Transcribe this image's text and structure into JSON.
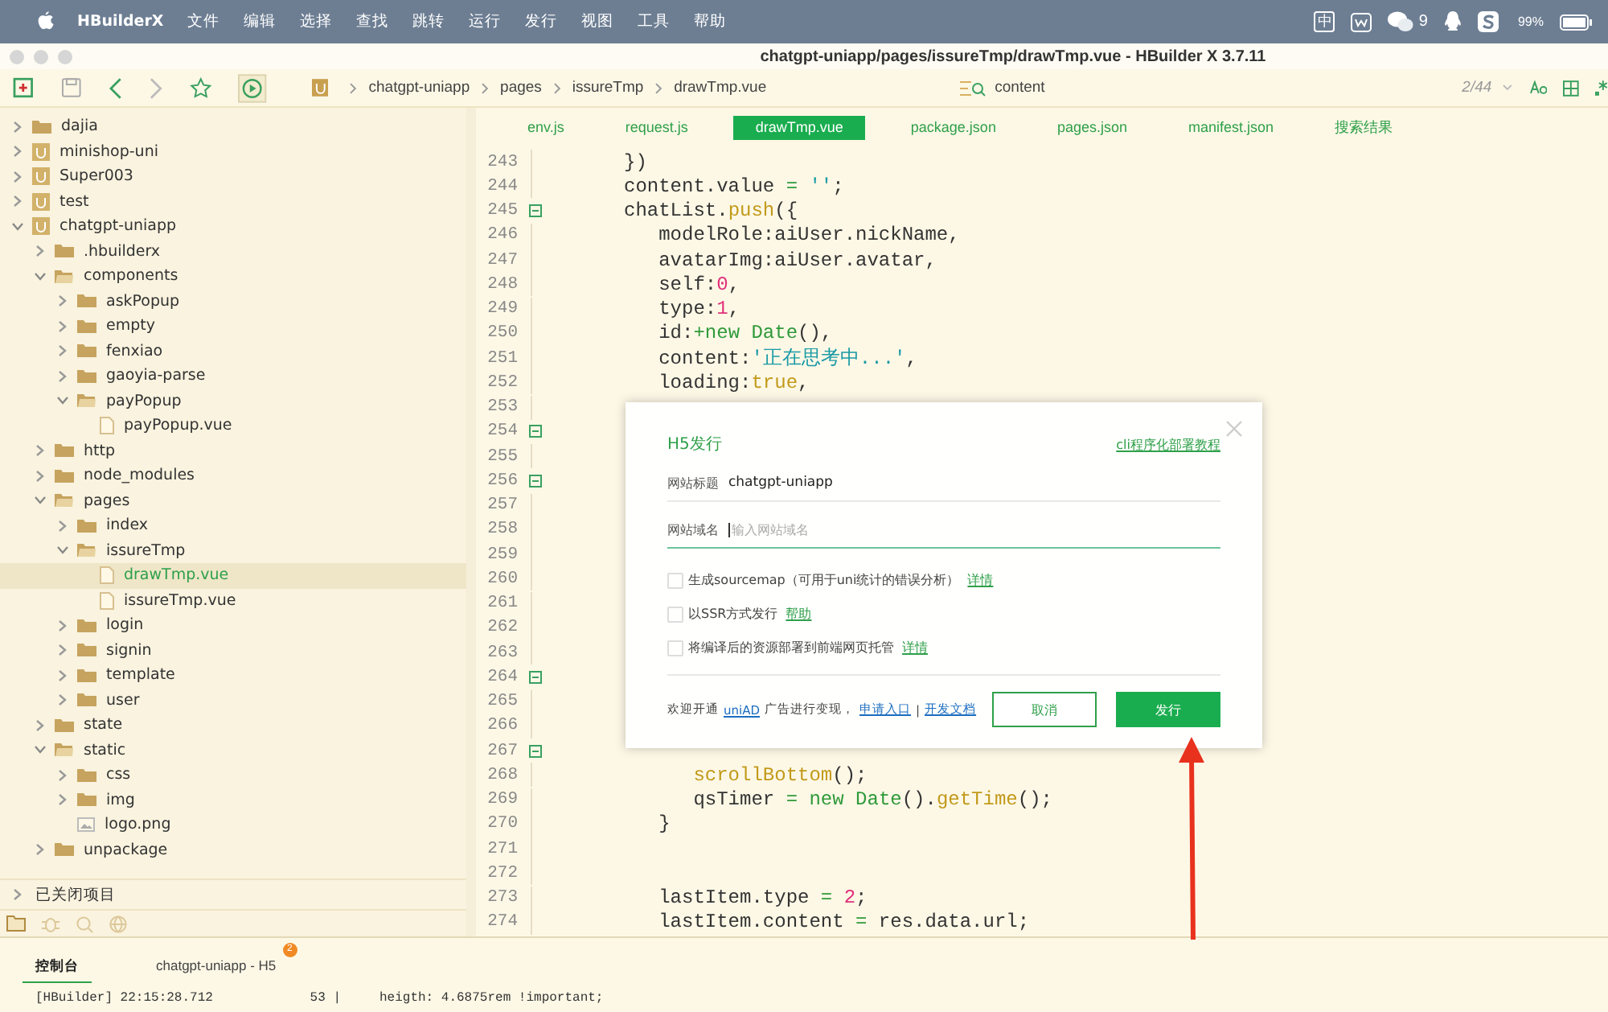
{
  "menubar": {
    "items": [
      "HBuilderX",
      "文件",
      "编辑",
      "选择",
      "查找",
      "跳转",
      "运行",
      "发行",
      "视图",
      "工具",
      "帮助"
    ],
    "input_method": "中",
    "wechat_count": "9",
    "battery": "99%"
  },
  "window": {
    "title": "chatgpt-uniapp/pages/issureTmp/drawTmp.vue - HBuilder X 3.7.11"
  },
  "toolbar": {
    "breadcrumb": [
      "chatgpt-uniapp",
      "pages",
      "issureTmp",
      "drawTmp.vue"
    ],
    "search": {
      "value": "content"
    },
    "match_count": "2/44"
  },
  "tabs": [
    {
      "label": "env.js",
      "selected": false
    },
    {
      "label": "request.js",
      "selected": false
    },
    {
      "label": "drawTmp.vue",
      "selected": true
    },
    {
      "label": "package.json",
      "selected": false
    },
    {
      "label": "pages.json",
      "selected": false
    },
    {
      "label": "manifest.json",
      "selected": false
    },
    {
      "label": "搜索结果",
      "selected": false
    }
  ],
  "sidebar": {
    "tree": [
      {
        "label": "dajia",
        "kind": "folder",
        "expanded": false,
        "selected": false
      },
      {
        "label": "minishop-uni",
        "kind": "project",
        "expanded": false,
        "selected": false
      },
      {
        "label": "Super003",
        "kind": "project",
        "expanded": false,
        "selected": false
      },
      {
        "label": "test",
        "kind": "project",
        "expanded": false,
        "selected": false
      },
      {
        "label": "chatgpt-uniapp",
        "kind": "project",
        "expanded": true,
        "selected": false,
        "children": [
          {
            "label": ".hbuilderx",
            "kind": "folder",
            "expanded": false,
            "selected": false
          },
          {
            "label": "components",
            "kind": "folder",
            "expanded": true,
            "selected": false,
            "children": [
              {
                "label": "askPopup",
                "kind": "folder",
                "expanded": false,
                "selected": false
              },
              {
                "label": "empty",
                "kind": "folder",
                "expanded": false,
                "selected": false
              },
              {
                "label": "fenxiao",
                "kind": "folder",
                "expanded": false,
                "selected": false
              },
              {
                "label": "gaoyia-parse",
                "kind": "folder",
                "expanded": false,
                "selected": false
              },
              {
                "label": "payPopup",
                "kind": "folder",
                "expanded": true,
                "selected": false,
                "children": [
                  {
                    "label": "payPopup.vue",
                    "kind": "file",
                    "selected": false
                  }
                ]
              }
            ]
          },
          {
            "label": "http",
            "kind": "folder",
            "expanded": false,
            "selected": false
          },
          {
            "label": "node_modules",
            "kind": "folder",
            "expanded": false,
            "selected": false
          },
          {
            "label": "pages",
            "kind": "folder",
            "expanded": true,
            "selected": false,
            "children": [
              {
                "label": "index",
                "kind": "folder",
                "expanded": false,
                "selected": false
              },
              {
                "label": "issureTmp",
                "kind": "folder",
                "expanded": true,
                "selected": false,
                "children": [
                  {
                    "label": "drawTmp.vue",
                    "kind": "file",
                    "selected": true
                  },
                  {
                    "label": "issureTmp.vue",
                    "kind": "file",
                    "selected": false
                  }
                ]
              },
              {
                "label": "login",
                "kind": "folder",
                "expanded": false,
                "selected": false
              },
              {
                "label": "signin",
                "kind": "folder",
                "expanded": false,
                "selected": false
              },
              {
                "label": "template",
                "kind": "folder",
                "expanded": false,
                "selected": false
              },
              {
                "label": "user",
                "kind": "folder",
                "expanded": false,
                "selected": false
              }
            ]
          },
          {
            "label": "state",
            "kind": "folder",
            "expanded": false,
            "selected": false
          },
          {
            "label": "static",
            "kind": "folder",
            "expanded": true,
            "selected": false,
            "children": [
              {
                "label": "css",
                "kind": "folder",
                "expanded": false,
                "selected": false
              },
              {
                "label": "img",
                "kind": "folder",
                "expanded": false,
                "selected": false
              },
              {
                "label": "logo.png",
                "kind": "image",
                "selected": false
              }
            ]
          },
          {
            "label": "unpackage",
            "kind": "folder",
            "expanded": false,
            "selected": false
          }
        ]
      }
    ],
    "closed_projects": {
      "label": "已关闭项目",
      "expanded": false
    }
  },
  "editor": {
    "lines": [
      {
        "number": "243",
        "fold": false,
        "segments": [
          {
            "text": "})",
            "kind": "plain"
          }
        ]
      },
      {
        "number": "244",
        "fold": false,
        "segments": [
          {
            "text": "content.value ",
            "kind": "plain"
          },
          {
            "text": "= ",
            "kind": "keyword"
          },
          {
            "text": "''",
            "kind": "string"
          },
          {
            "text": ";",
            "kind": "plain"
          }
        ]
      },
      {
        "number": "245",
        "fold": true,
        "segments": [
          {
            "text": "chatList.",
            "kind": "plain"
          },
          {
            "text": "push",
            "kind": "func"
          },
          {
            "text": "({",
            "kind": "plain"
          }
        ]
      },
      {
        "number": "246",
        "fold": false,
        "segments": [
          {
            "text": "   modelRole:aiUser.nickName,",
            "kind": "plain"
          }
        ]
      },
      {
        "number": "247",
        "fold": false,
        "segments": [
          {
            "text": "   avatarImg:aiUser.avatar,",
            "kind": "plain"
          }
        ]
      },
      {
        "number": "248",
        "fold": false,
        "segments": [
          {
            "text": "   self:",
            "kind": "plain"
          },
          {
            "text": "0",
            "kind": "number"
          },
          {
            "text": ",",
            "kind": "plain"
          }
        ]
      },
      {
        "number": "249",
        "fold": false,
        "segments": [
          {
            "text": "   type:",
            "kind": "plain"
          },
          {
            "text": "1",
            "kind": "number"
          },
          {
            "text": ",",
            "kind": "plain"
          }
        ]
      },
      {
        "number": "250",
        "fold": false,
        "segments": [
          {
            "text": "   id:",
            "kind": "plain"
          },
          {
            "text": "+new Date",
            "kind": "keyword"
          },
          {
            "text": "(),",
            "kind": "plain"
          }
        ]
      },
      {
        "number": "251",
        "fold": false,
        "segments": [
          {
            "text": "   content:",
            "kind": "plain"
          },
          {
            "text": "'正在思考中...'",
            "kind": "string"
          },
          {
            "text": ",",
            "kind": "plain"
          }
        ]
      },
      {
        "number": "252",
        "fold": false,
        "segments": [
          {
            "text": "   loading:",
            "kind": "plain"
          },
          {
            "text": "true",
            "kind": "func"
          },
          {
            "text": ",",
            "kind": "plain"
          }
        ]
      },
      {
        "number": "253",
        "fold": false
      },
      {
        "number": "254",
        "fold": true
      },
      {
        "number": "255",
        "fold": false
      },
      {
        "number": "256",
        "fold": true
      },
      {
        "number": "257",
        "fold": false
      },
      {
        "number": "258",
        "fold": false
      },
      {
        "number": "259",
        "fold": false
      },
      {
        "number": "260",
        "fold": false
      },
      {
        "number": "261",
        "fold": false
      },
      {
        "number": "262",
        "fold": false
      },
      {
        "number": "263",
        "fold": false
      },
      {
        "number": "264",
        "fold": true
      },
      {
        "number": "265",
        "fold": false
      },
      {
        "number": "266",
        "fold": false
      },
      {
        "number": "267",
        "fold": true
      },
      {
        "number": "268",
        "fold": false,
        "segments": [
          {
            "text": "      scrollBottom",
            "kind": "func"
          },
          {
            "text": "();",
            "kind": "plain"
          }
        ]
      },
      {
        "number": "269",
        "fold": false,
        "segments": [
          {
            "text": "      qsTimer ",
            "kind": "plain"
          },
          {
            "text": "= new Date",
            "kind": "keyword"
          },
          {
            "text": "().",
            "kind": "plain"
          },
          {
            "text": "getTime",
            "kind": "func"
          },
          {
            "text": "();",
            "kind": "plain"
          }
        ]
      },
      {
        "number": "270",
        "fold": false,
        "segments": [
          {
            "text": "   }",
            "kind": "plain"
          }
        ]
      },
      {
        "number": "271",
        "fold": false
      },
      {
        "number": "272",
        "fold": false
      },
      {
        "number": "273",
        "fold": false,
        "segments": [
          {
            "text": "   lastItem.type ",
            "kind": "plain"
          },
          {
            "text": "= ",
            "kind": "keyword"
          },
          {
            "text": "2",
            "kind": "number"
          },
          {
            "text": ";",
            "kind": "plain"
          }
        ]
      },
      {
        "number": "274",
        "fold": false,
        "segments": [
          {
            "text": "   lastItem.content ",
            "kind": "plain"
          },
          {
            "text": "=",
            "kind": "keyword"
          },
          {
            "text": " res.data.url;",
            "kind": "plain"
          }
        ]
      }
    ]
  },
  "dialog": {
    "title": "H5发行",
    "help_link": "cli程序化部署教程",
    "fields": [
      {
        "label": "网站标题",
        "value": "chatgpt-uniapp",
        "focused": false
      },
      {
        "label": "网站域名",
        "placeholder": "输入网站域名",
        "focused": true
      }
    ],
    "options": [
      {
        "label": "生成sourcemap（可用于uni统计的错误分析）",
        "link": "详情",
        "checked": false
      },
      {
        "label": "以SSR方式发行",
        "link": "帮助",
        "checked": false
      },
      {
        "label": "将编译后的资源部署到前端网页托管",
        "link": "详情",
        "checked": false
      }
    ],
    "footer": {
      "text_before": "欢迎开通",
      "ad_link": "uniAD",
      "text_after": "广告进行变现，",
      "apply_link": "申请入口",
      "separator": "|",
      "docs_link": "开发文档"
    },
    "buttons": [
      {
        "label": "取消",
        "kind": "secondary"
      },
      {
        "label": "发行",
        "kind": "primary"
      }
    ]
  },
  "console": {
    "tabs": [
      {
        "label": "控制台",
        "selected": true
      },
      {
        "label": "chatgpt-uniapp - H5",
        "selected": false,
        "badge": "2"
      }
    ],
    "log": {
      "source": "[HBuilder] 22:15:28.712",
      "line": "53 |",
      "message": "heigth: 4.6875rem !important;"
    }
  }
}
